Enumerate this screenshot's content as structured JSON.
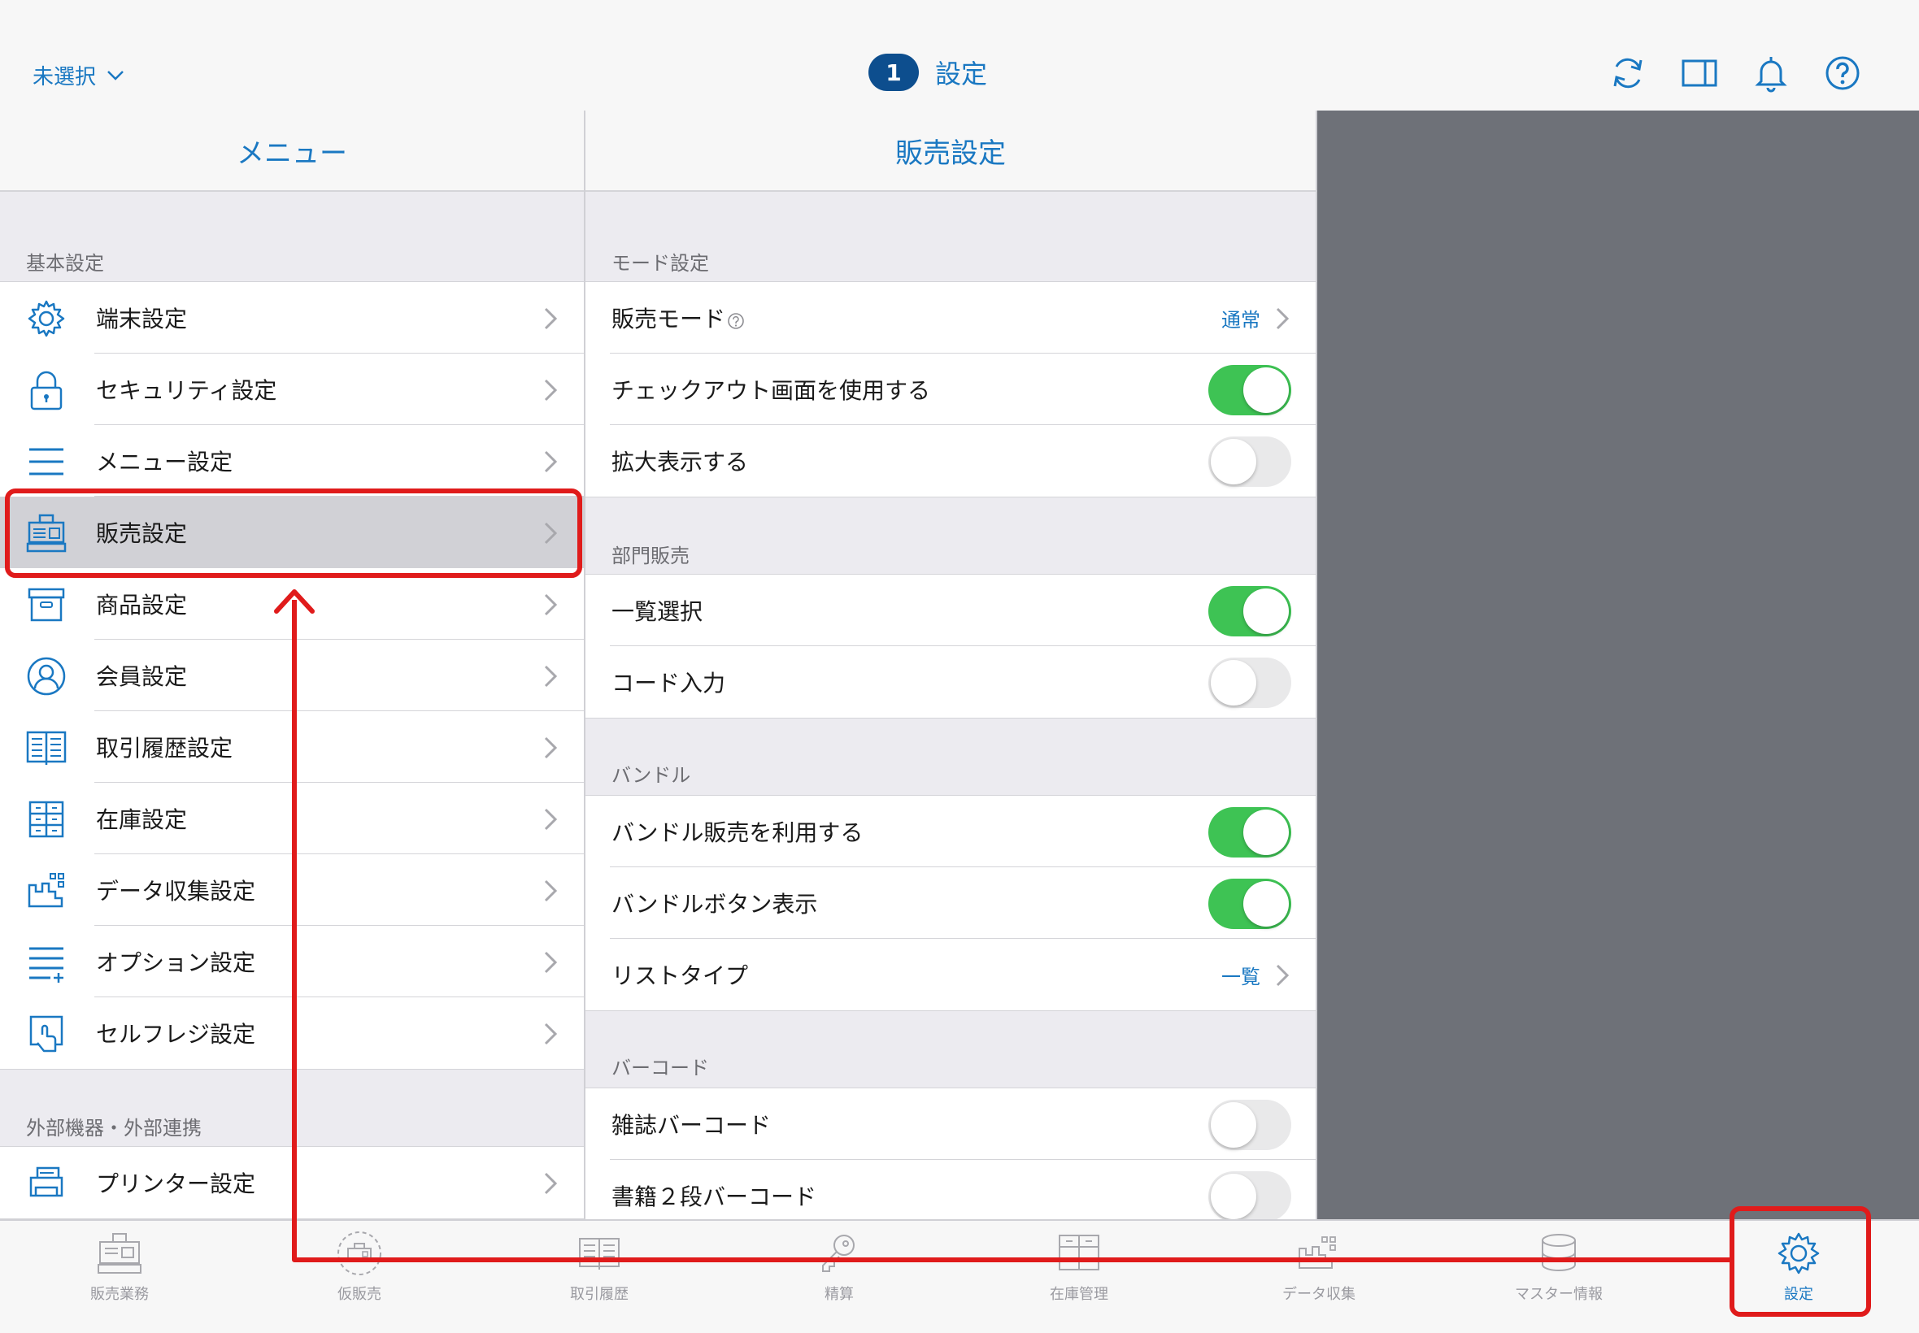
{
  "topbar": {
    "store_selector": "未選択",
    "badge": "1",
    "title": "設定",
    "icons": [
      "sync-icon",
      "split-view-icon",
      "notification-bell-icon",
      "help-icon"
    ]
  },
  "menu": {
    "header": "メニュー",
    "sections": [
      {
        "label": "基本設定"
      },
      {
        "label": "外部機器・外部連携"
      }
    ],
    "items": [
      {
        "label": "端末設定",
        "icon": "gear-icon"
      },
      {
        "label": "セキュリティ設定",
        "icon": "lock-icon"
      },
      {
        "label": "メニュー設定",
        "icon": "hamburger-menu-icon"
      },
      {
        "label": "販売設定",
        "icon": "cash-register-icon",
        "selected": true
      },
      {
        "label": "商品設定",
        "icon": "product-box-icon"
      },
      {
        "label": "会員設定",
        "icon": "member-icon"
      },
      {
        "label": "取引履歴設定",
        "icon": "transaction-book-icon"
      },
      {
        "label": "在庫設定",
        "icon": "inventory-cabinet-icon"
      },
      {
        "label": "データ収集設定",
        "icon": "data-collection-icon"
      },
      {
        "label": "オプション設定",
        "icon": "option-list-icon"
      },
      {
        "label": "セルフレジ設定",
        "icon": "self-checkout-icon"
      },
      {
        "label": "プリンター設定",
        "icon": "printer-icon"
      }
    ]
  },
  "detail": {
    "header": "販売設定",
    "sections": [
      {
        "label": "モード設定"
      },
      {
        "label": "部門販売"
      },
      {
        "label": "バンドル"
      },
      {
        "label": "バーコード"
      }
    ],
    "rows": [
      {
        "label": "販売モード",
        "value": "通常",
        "type": "link",
        "has_help": true
      },
      {
        "label": "チェックアウト画面を使用する",
        "type": "toggle",
        "on": true
      },
      {
        "label": "拡大表示する",
        "type": "toggle",
        "on": false
      },
      {
        "label": "一覧選択",
        "type": "toggle",
        "on": true
      },
      {
        "label": "コード入力",
        "type": "toggle",
        "on": false
      },
      {
        "label": "バンドル販売を利用する",
        "type": "toggle",
        "on": true
      },
      {
        "label": "バンドルボタン表示",
        "type": "toggle",
        "on": true
      },
      {
        "label": "リストタイプ",
        "value": "一覧",
        "type": "link"
      },
      {
        "label": "雑誌バーコード",
        "type": "toggle",
        "on": false
      },
      {
        "label": "書籍２段バーコード",
        "type": "toggle",
        "on": false
      }
    ]
  },
  "tabbar": {
    "tabs": [
      {
        "label": "販売業務",
        "icon": "cash-register-icon"
      },
      {
        "label": "仮販売",
        "icon": "provisional-sale-icon"
      },
      {
        "label": "取引履歴",
        "icon": "transaction-book-icon"
      },
      {
        "label": "精算",
        "icon": "settlement-key-icon"
      },
      {
        "label": "在庫管理",
        "icon": "inventory-cabinet-icon"
      },
      {
        "label": "データ収集",
        "icon": "data-collection-icon"
      },
      {
        "label": "マスター情報",
        "icon": "database-icon"
      },
      {
        "label": "設定",
        "icon": "gear-icon",
        "active": true
      }
    ]
  },
  "colors": {
    "accent": "#1a78c2",
    "badge": "#0d4e8e",
    "toggle_on": "#3ec354",
    "annotation": "#e01b1b",
    "right_pane": "#6e7178"
  }
}
